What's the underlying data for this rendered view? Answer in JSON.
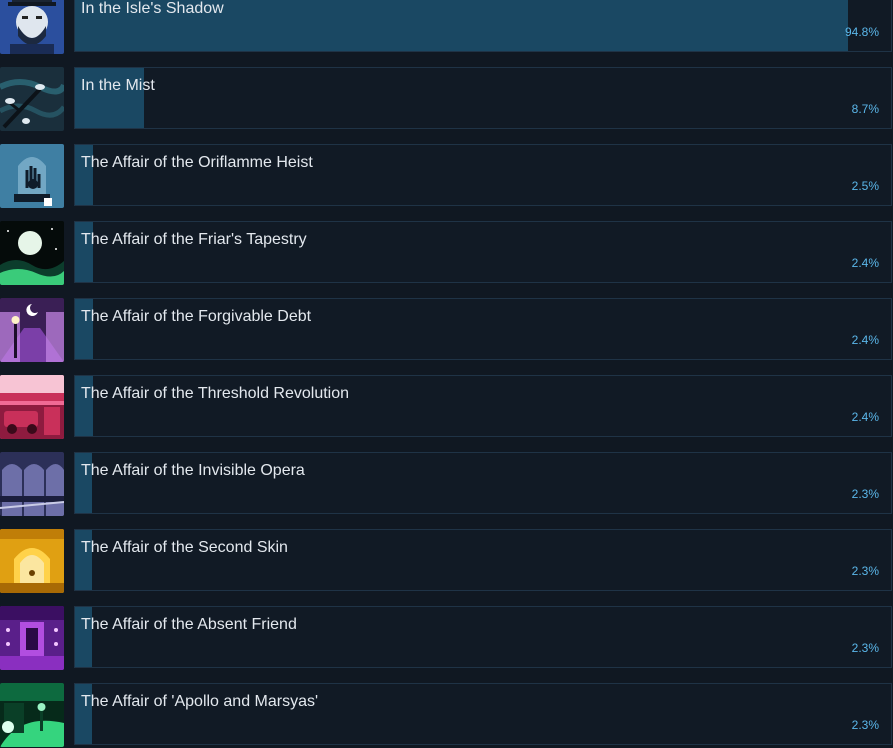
{
  "achievements": [
    {
      "title": "In the Isle's Shadow",
      "percent_label": "94.8%",
      "percent": 94.8,
      "icon": "sailor-portrait-icon",
      "colors": [
        "#2b4f9e",
        "#dfe6ee"
      ]
    },
    {
      "title": "In the Mist",
      "percent_label": "8.7%",
      "percent": 8.7,
      "icon": "misty-branch-icon",
      "colors": [
        "#2d6b7a",
        "#1a2f3c"
      ]
    },
    {
      "title": "The Affair of the Oriflamme Heist",
      "percent_label": "2.5%",
      "percent": 2.5,
      "icon": "hand-under-glass-dome-icon",
      "colors": [
        "#3f7fa3",
        "#0f1c2a"
      ]
    },
    {
      "title": "The Affair of the Friar's Tapestry",
      "percent_label": "2.4%",
      "percent": 2.4,
      "icon": "moonlit-hills-icon",
      "colors": [
        "#0c3d2c",
        "#3acb7a"
      ]
    },
    {
      "title": "The Affair of the Forgivable Debt",
      "percent_label": "2.4%",
      "percent": 2.4,
      "icon": "night-street-lamp-icon",
      "colors": [
        "#7b3fa8",
        "#c889e8"
      ]
    },
    {
      "title": "The Affair of the Threshold Revolution",
      "percent_label": "2.4%",
      "percent": 2.4,
      "icon": "red-street-car-icon",
      "colors": [
        "#c9305a",
        "#f06a95"
      ]
    },
    {
      "title": "The Affair of the Invisible Opera",
      "percent_label": "2.3%",
      "percent": 2.3,
      "icon": "opera-arches-icon",
      "colors": [
        "#2c3058",
        "#6d6fa8"
      ]
    },
    {
      "title": "The Affair of the Second Skin",
      "percent_label": "2.3%",
      "percent": 2.3,
      "icon": "golden-archway-icon",
      "colors": [
        "#e0a012",
        "#ffd24a"
      ]
    },
    {
      "title": "The Affair of the Absent Friend",
      "percent_label": "2.3%",
      "percent": 2.3,
      "icon": "purple-hall-icon",
      "colors": [
        "#5a1f8a",
        "#b24ee0"
      ]
    },
    {
      "title": "The Affair of 'Apollo and Marsyas'",
      "percent_label": "2.3%",
      "percent": 2.3,
      "icon": "green-garden-icon",
      "colors": [
        "#0d6a3f",
        "#35d47e"
      ]
    }
  ]
}
